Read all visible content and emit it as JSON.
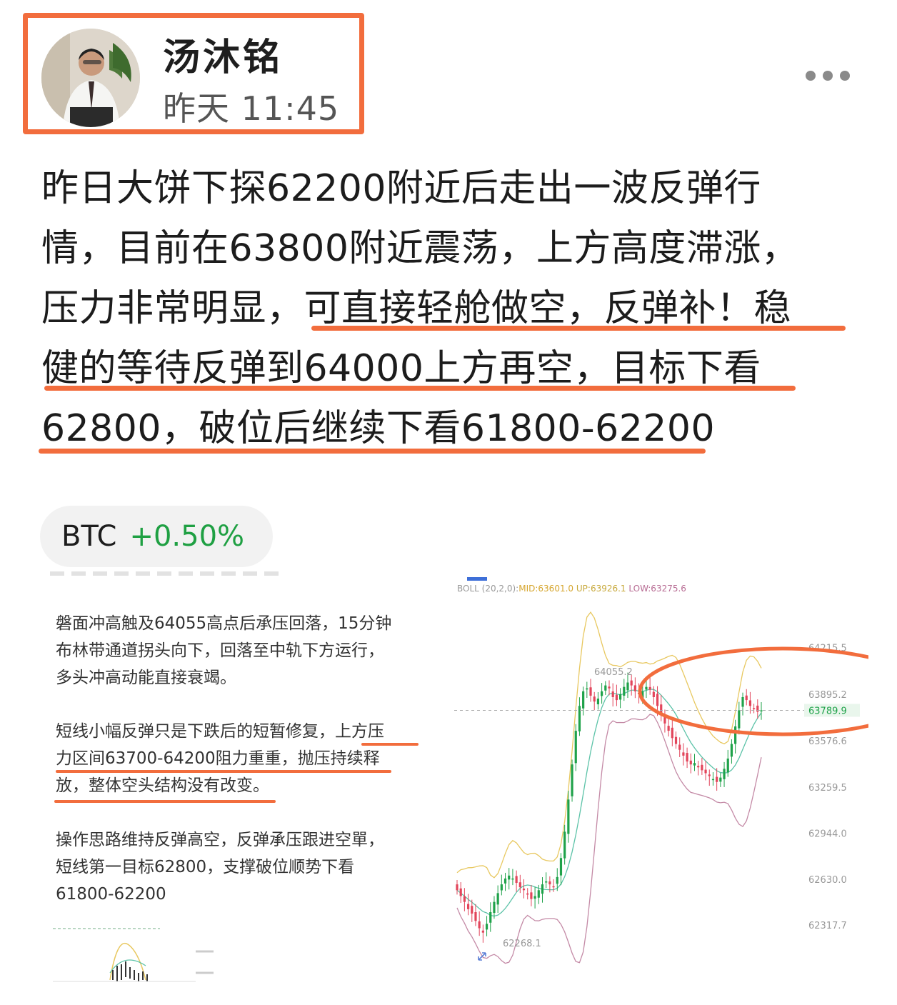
{
  "header": {
    "author_name": "汤沐铭",
    "post_time": "昨天 11:45",
    "more_icon": "more-horizontal-icon",
    "accent_color": "#f26d3d"
  },
  "post": {
    "lines": [
      "昨日大饼下探62200附近后走出一波反弹行",
      "情，目前在63800附近震荡，上方高度滞涨，",
      "压力非常明显，可直接轻舱做空，反弹补！稳",
      "健的等待反弹到64000上方再空，目标下看",
      "62800，破位后继续下看61800-62200"
    ]
  },
  "ticker": {
    "symbol": "BTC",
    "change": "+0.50%",
    "change_color": "#1fa043"
  },
  "screenshot": {
    "paragraph1": [
      "磐面冲高触及64055高点后承压回落，15分钟",
      "布林带通道拐头向下，回落至中轨下方运行，",
      "多头冲高动能直接衰竭。"
    ],
    "paragraph2": [
      "短线小幅反弹只是下跌后的短暂修复，上方压",
      "力区间63700-64200阻力重重，抛压持续释",
      "放，整体空头结构没有改变。"
    ],
    "paragraph3": [
      "操作思路维持反弹高空，反弹承压跟进空單，",
      "短线第一目标62800，支撑破位顺势下看",
      "61800-62200"
    ]
  },
  "chart_data": {
    "type": "line",
    "title": "",
    "indicator_label": "BOLL (20,2,0):",
    "mid_label": "MID:63601.0",
    "up_label": "UP:63926.1",
    "low_label": "LOW:63275.6",
    "price_axis": [
      "64215.5",
      "63895.2",
      "63789.9",
      "63576.6",
      "63259.5",
      "62944.0",
      "62630.0",
      "62317.7"
    ],
    "current_price": "63789.9",
    "high_label": "64055.2",
    "low_mark_label": "62268.1",
    "ylim": [
      62200,
      64300
    ],
    "colors": {
      "up": "#1fa24a",
      "down": "#e2455b",
      "upper_band": "#e8c860",
      "mid_band": "#5cc3a8",
      "lower_band": "#c48aa6"
    },
    "series": [
      {
        "values": [
          62560,
          62520,
          62480,
          62430,
          62400,
          62350,
          62300,
          62270,
          62330,
          62410,
          62480,
          62540,
          62600,
          62640,
          62660,
          62640,
          62610,
          62580,
          62560,
          62530,
          62500,
          62520,
          62560,
          62600,
          62620,
          62600,
          62580,
          62650,
          62780,
          62960,
          63180,
          63420,
          63650,
          63820,
          63920,
          63940,
          63890,
          63850,
          63870,
          63920,
          63960,
          63940,
          63880,
          63860,
          63900,
          63950,
          63980,
          63960,
          63920,
          63900,
          63920,
          63950,
          63930,
          63880,
          63820,
          63760,
          63700,
          63650,
          63600,
          63560,
          63520,
          63480,
          63440,
          63420,
          63430,
          63400,
          63380,
          63360,
          63340,
          63320,
          63300,
          63330,
          63390,
          63460,
          63560,
          63680,
          63790,
          63880,
          63860,
          63820,
          63800,
          63780,
          63789.9
        ]
      }
    ]
  }
}
